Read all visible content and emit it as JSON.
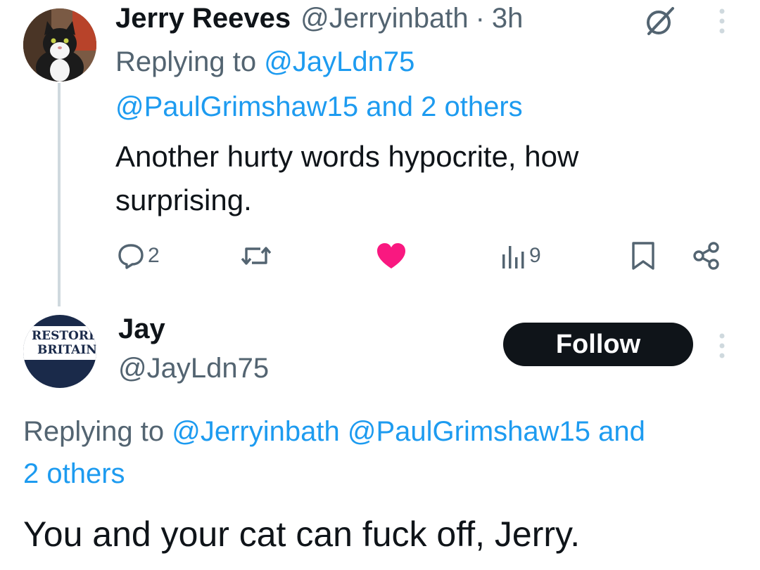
{
  "colors": {
    "text": "#0f1419",
    "secondary": "#536471",
    "link": "#1d9bf0",
    "like": "#f91880",
    "thread_line": "#cfd9de",
    "follow_bg": "#0f1419"
  },
  "tweet1": {
    "name": "Jerry Reeves",
    "handle": "@Jerryinbath",
    "separator": "·",
    "time": "3h",
    "replying_prefix": "Replying to",
    "replying_to": "@JayLdn75",
    "replying_more": "@PaulGrimshaw15 and 2 others",
    "text": "Another hurty words hypocrite, how surprising.",
    "icons": {
      "grok": "grok-icon",
      "more": "more-vertical-icon",
      "reply": "reply-icon",
      "retweet": "retweet-icon",
      "like": "heart-filled-icon",
      "views": "views-bar-chart-icon",
      "bookmark": "bookmark-icon",
      "share": "share-icon"
    },
    "reply_count": "2",
    "views_count": "9"
  },
  "tweet2": {
    "name": "Jay",
    "handle": "@JayLdn75",
    "avatar_logo_line1": "RESTORE",
    "avatar_logo_line2": "BRITAIN",
    "follow_label": "Follow",
    "replying_prefix": "Replying to",
    "replying_mentions": "@Jerryinbath @PaulGrimshaw15 and",
    "replying_others": "2 others",
    "text": "You and your cat can fuck off, Jerry."
  }
}
